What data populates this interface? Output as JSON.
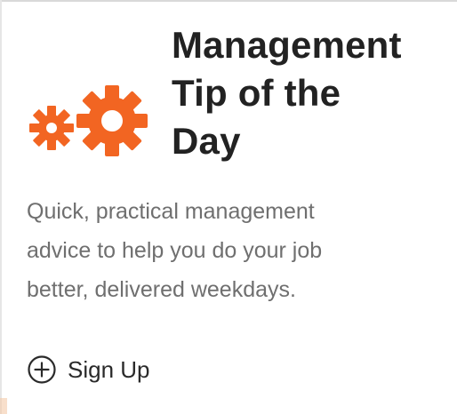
{
  "card": {
    "title_lines": [
      "Management",
      "Tip of the",
      "Day"
    ],
    "description_lines": [
      "Quick, practical management",
      "advice to help you do your job",
      "better, delivered weekdays."
    ],
    "signup_label": "Sign Up",
    "icons": {
      "logo": "gears-icon",
      "signup": "plus-circle-icon"
    }
  },
  "colors": {
    "accent": "#f26522",
    "title": "#222222",
    "description": "#6f6f6f"
  }
}
